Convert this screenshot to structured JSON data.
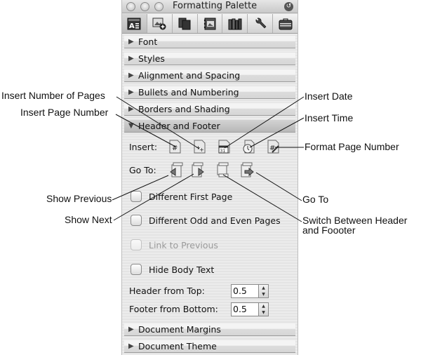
{
  "window": {
    "title": "Formatting Palette",
    "traffic_lights": [
      "close",
      "minimize",
      "zoom"
    ],
    "collapse_icon": "collapse-icon"
  },
  "toolbar": {
    "buttons": [
      {
        "name": "formatting-icon",
        "active": true
      },
      {
        "name": "object-palette-icon",
        "active": false
      },
      {
        "name": "citations-icon",
        "active": false
      },
      {
        "name": "scrapbook-icon",
        "active": false
      },
      {
        "name": "reference-tools-icon",
        "active": false
      },
      {
        "name": "compatibility-report-icon",
        "active": false
      },
      {
        "name": "project-palette-icon",
        "active": false
      }
    ]
  },
  "sections": {
    "font": "Font",
    "styles": "Styles",
    "alignment": "Alignment and Spacing",
    "bullets": "Bullets and Numbering",
    "borders": "Borders and Shading",
    "header_footer": "Header and Footer",
    "margins": "Document Margins",
    "theme": "Document Theme"
  },
  "header_footer": {
    "insert_label": "Insert:",
    "insert_icons": [
      "page-number-icon",
      "number-of-pages-icon",
      "date-icon",
      "time-icon",
      "format-page-number-icon"
    ],
    "goto_label": "Go To:",
    "goto_icons": [
      "show-previous-icon",
      "show-next-icon",
      "switch-header-footer-icon",
      "go-to-icon"
    ],
    "checkboxes": [
      {
        "label": "Different First Page",
        "checked": false,
        "enabled": true
      },
      {
        "label": "Different Odd and Even Pages",
        "checked": false,
        "enabled": true
      },
      {
        "label": "Link to Previous",
        "checked": false,
        "enabled": false
      },
      {
        "label": "Hide Body Text",
        "checked": false,
        "enabled": true
      }
    ],
    "header_from_top": {
      "label": "Header from Top:",
      "value": "0.5"
    },
    "footer_from_bottom": {
      "label": "Footer from Bottom:",
      "value": "0.5"
    }
  },
  "callouts": {
    "insert_number_of_pages": "Insert Number of Pages",
    "insert_page_number": "Insert Page Number",
    "insert_date": "Insert Date",
    "insert_time": "Insert Time",
    "format_page_number": "Format Page Number",
    "show_previous": "Show Previous",
    "show_next": "Show Next",
    "go_to": "Go To",
    "switch_line1": "Switch Between Header",
    "switch_line2": "and Foooter"
  }
}
